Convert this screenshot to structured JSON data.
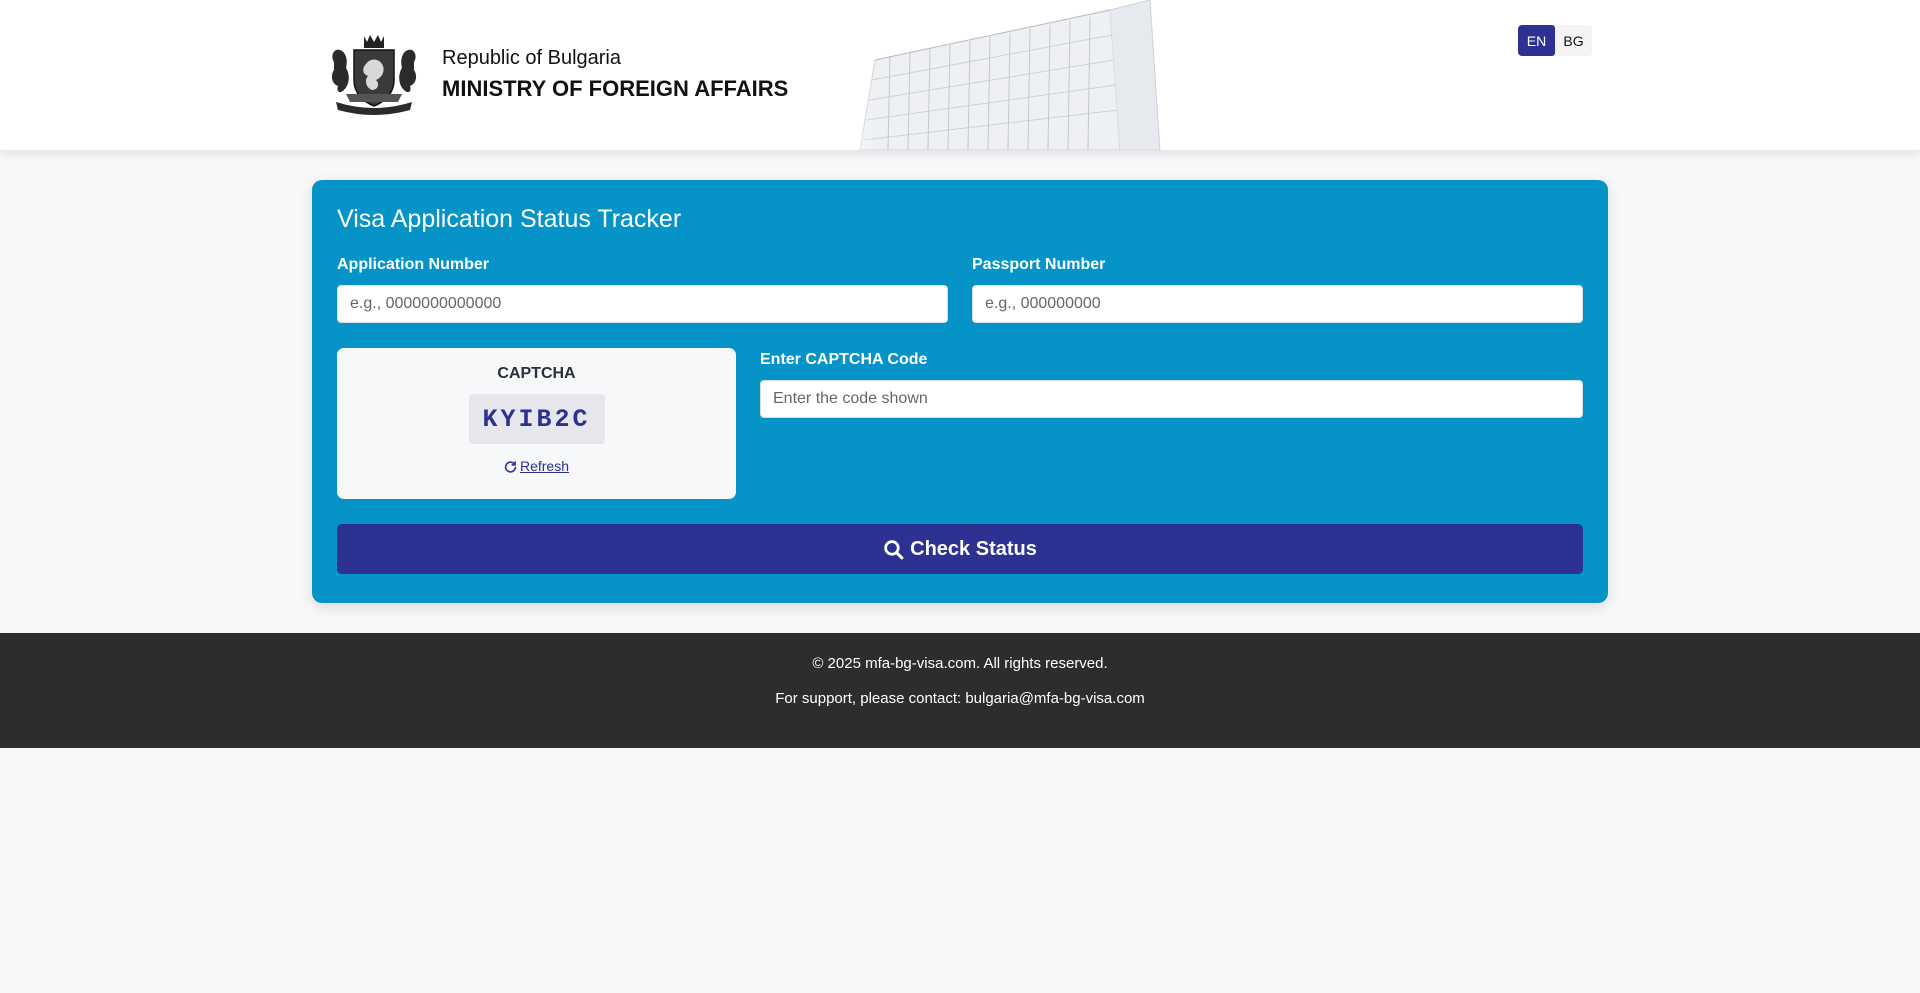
{
  "header": {
    "country": "Republic of Bulgaria",
    "ministry": "MINISTRY OF FOREIGN AFFAIRS",
    "logo_icon": "bulgaria-coat-of-arms",
    "languages": [
      {
        "label": "EN",
        "active": true
      },
      {
        "label": "BG",
        "active": false
      }
    ]
  },
  "tracker": {
    "title": "Visa Application Status Tracker",
    "application_number": {
      "label": "Application Number",
      "placeholder": "e.g., 0000000000000",
      "value": ""
    },
    "passport_number": {
      "label": "Passport Number",
      "placeholder": "e.g., 000000000",
      "value": ""
    },
    "captcha": {
      "label": "CAPTCHA",
      "code": "KYIB2C",
      "refresh_label": "Refresh",
      "refresh_icon": "refresh-icon"
    },
    "captcha_input": {
      "label": "Enter CAPTCHA Code",
      "placeholder": "Enter the code shown",
      "value": ""
    },
    "submit": {
      "label": "Check Status",
      "icon": "search-icon"
    }
  },
  "footer": {
    "copyright": "© 2025 mfa-bg-visa.com. All rights reserved.",
    "support": "For support, please contact: bulgaria@mfa-bg-visa.com"
  },
  "colors": {
    "primary": "#2d3292",
    "card": "#0593c8",
    "footer": "#2d2d2b",
    "page_bg": "#f7f8fa"
  }
}
